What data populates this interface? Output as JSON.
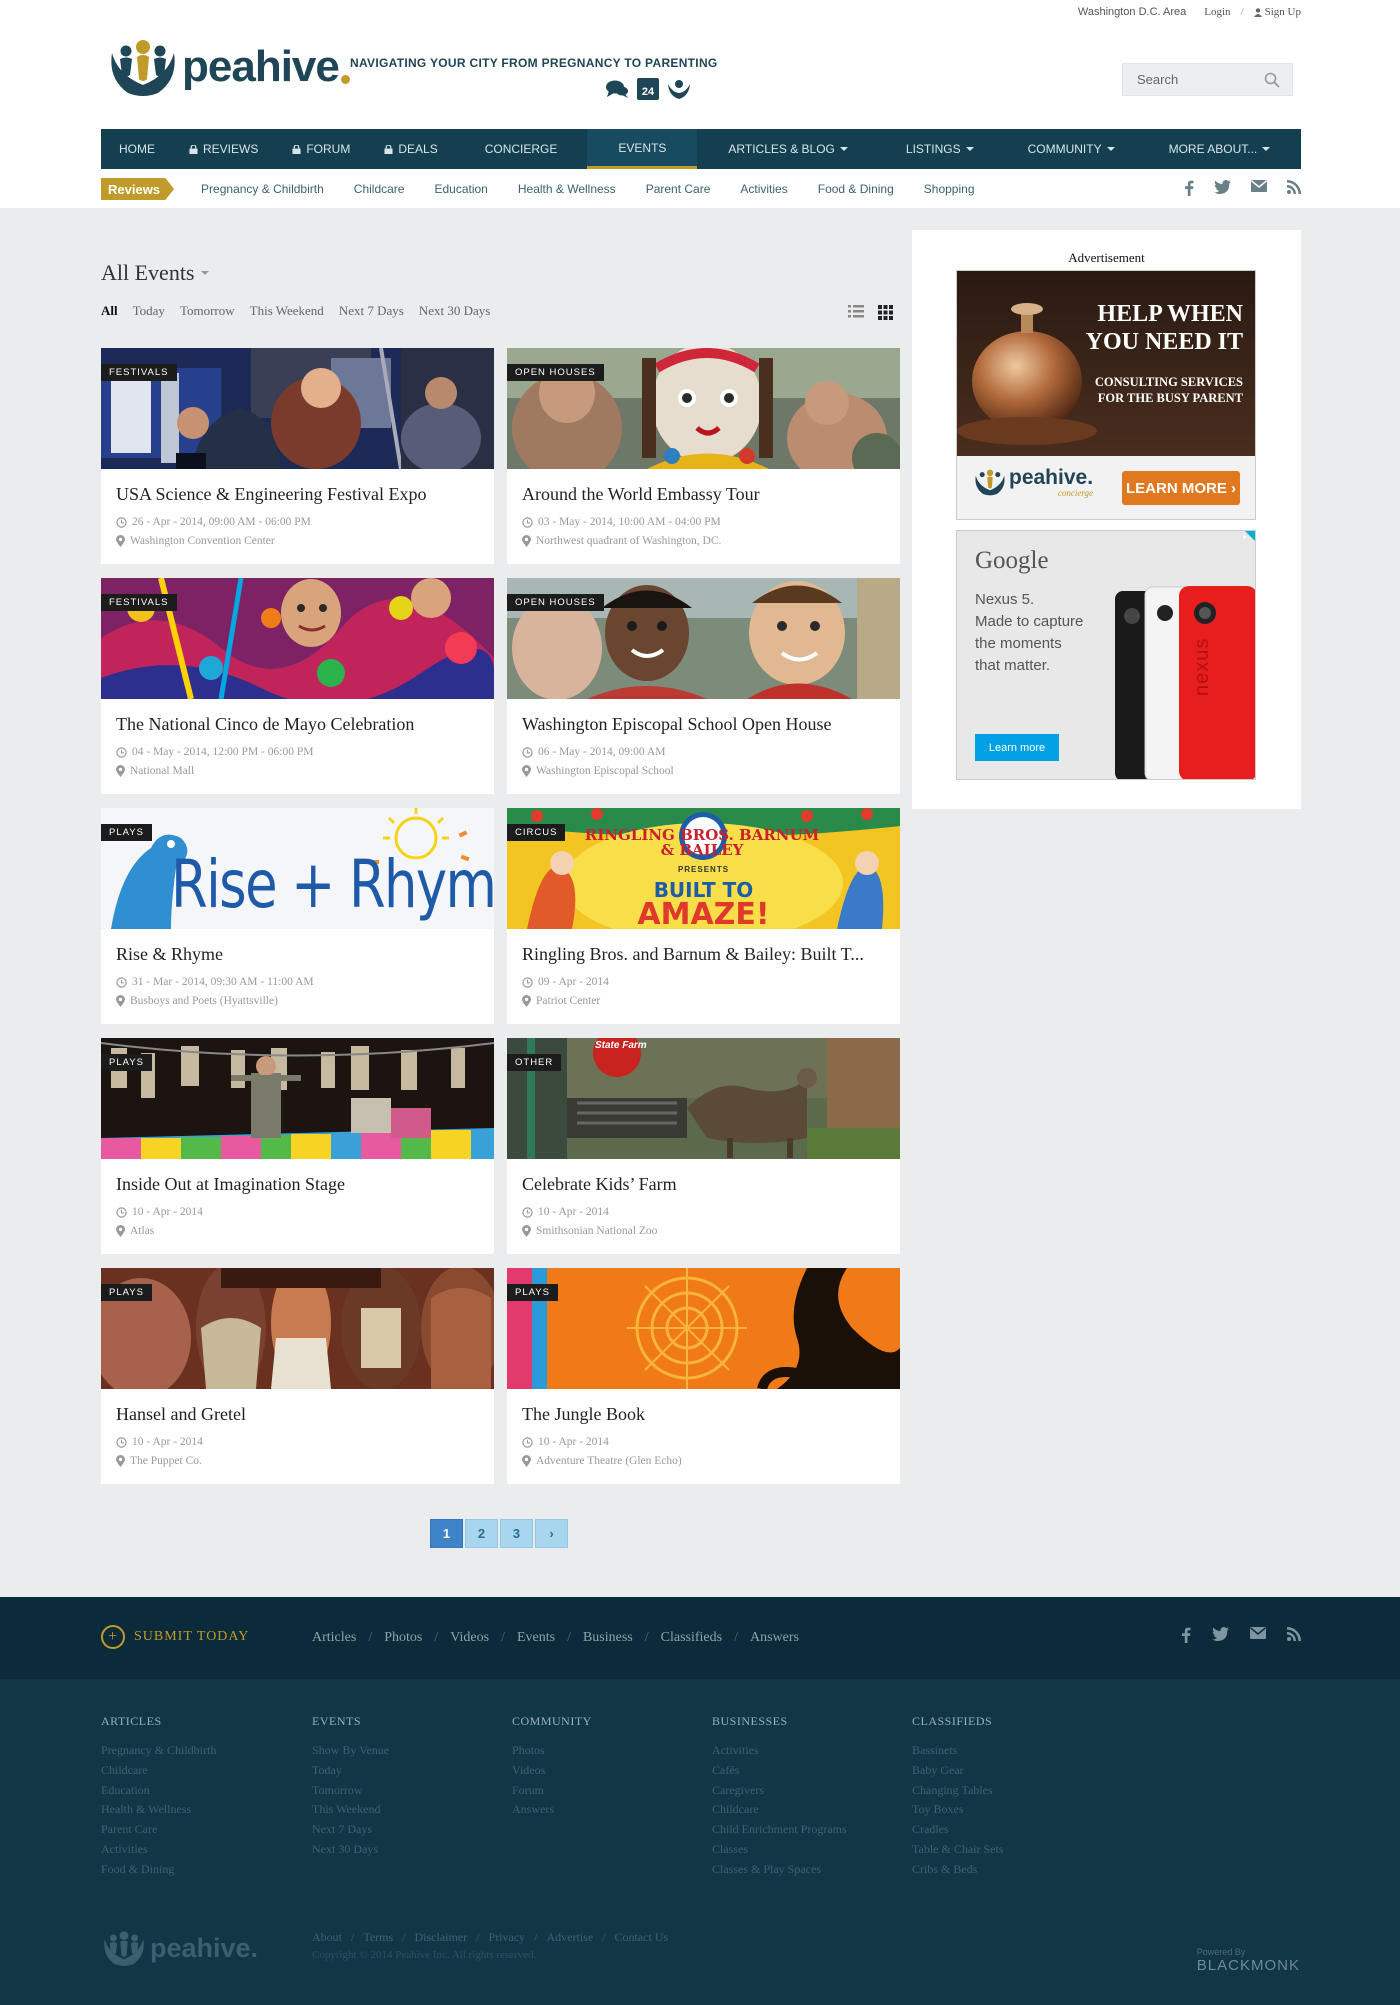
{
  "header": {
    "region": "Washington D.C. Area",
    "login": "Login",
    "signup": "Sign Up",
    "slash": "/",
    "brand": "peahive",
    "tagline": "NAVIGATING YOUR CITY FROM PREGNANCY TO PARENTING",
    "calendar_day": "24",
    "search_placeholder": "Search"
  },
  "main_nav": [
    {
      "label": "HOME"
    },
    {
      "label": "REVIEWS",
      "locked": true
    },
    {
      "label": "FORUM",
      "locked": true
    },
    {
      "label": "DEALS",
      "locked": true
    },
    {
      "label": "CONCIERGE"
    },
    {
      "label": "EVENTS",
      "active": true
    },
    {
      "label": "ARTICLES & BLOG",
      "dropdown": true
    },
    {
      "label": "LISTINGS",
      "dropdown": true
    },
    {
      "label": "COMMUNITY",
      "dropdown": true
    },
    {
      "label": "MORE ABOUT...",
      "dropdown": true
    }
  ],
  "sub_nav": {
    "badge": "Reviews",
    "items": [
      "Pregnancy & Childbirth",
      "Childcare",
      "Education",
      "Health & Wellness",
      "Parent Care",
      "Activities",
      "Food & Dining",
      "Shopping"
    ]
  },
  "events_page": {
    "heading": "All Events",
    "filters": [
      "All",
      "Today",
      "Tomorrow",
      "This Weekend",
      "Next 7 Days",
      "Next 30 Days"
    ],
    "active_filter": "All"
  },
  "events": [
    {
      "tag": "FESTIVALS",
      "title": "USA Science & Engineering Festival Expo",
      "date": "26 - Apr - 2014, 09:00 AM - 06:00 PM",
      "location": "Washington Convention Center"
    },
    {
      "tag": "OPEN HOUSES",
      "title": "Around the World Embassy Tour",
      "date": "03 - May - 2014, 10:00 AM - 04:00 PM",
      "location": "Northwest quadrant of Washington, DC."
    },
    {
      "tag": "FESTIVALS",
      "title": "The National Cinco de Mayo Celebration",
      "date": "04 - May - 2014, 12:00 PM - 06:00 PM",
      "location": "National Mall"
    },
    {
      "tag": "OPEN HOUSES",
      "title": "Washington Episcopal School Open House",
      "date": "06 - May - 2014, 09:00 AM",
      "location": "Washington Episcopal School"
    },
    {
      "tag": "PLAYS",
      "title": "Rise & Rhyme",
      "date": "31 - Mar - 2014, 09:30 AM - 11:00 AM",
      "location": "Busboys and Poets (Hyattsville)"
    },
    {
      "tag": "CIRCUS",
      "title": "Ringling Bros. and Barnum & Bailey: Built T...",
      "date": "09 - Apr - 2014",
      "location": "Patriot Center"
    },
    {
      "tag": "PLAYS",
      "title": "Inside Out at Imagination Stage",
      "date": "10 - Apr - 2014",
      "location": "Atlas"
    },
    {
      "tag": "OTHER",
      "title": "Celebrate Kids’ Farm",
      "date": "10 - Apr - 2014",
      "location": "Smithsonian National Zoo"
    },
    {
      "tag": "PLAYS",
      "title": "Hansel and Gretel",
      "date": "10 - Apr - 2014",
      "location": "The Puppet Co."
    },
    {
      "tag": "PLAYS",
      "title": "The Jungle Book",
      "date": "10 - Apr - 2014",
      "location": "Adventure Theatre (Glen Echo)"
    }
  ],
  "image_text": {
    "rise_rhyme": "Rise + Rhyme",
    "ringling_top": "RINGLING BROS. BARNUM & BAILEY",
    "ringling_presents": "PRESENTS",
    "ringling_built": "BUILT TO",
    "ringling_amaze": "AMAZE!",
    "statefarm": "State Farm"
  },
  "pagination": {
    "pages": [
      "1",
      "2",
      "3"
    ],
    "active": "1",
    "next": "›"
  },
  "sidebar": {
    "ad_label": "Advertisement",
    "ad1": {
      "line1": "HELP WHEN",
      "line2": "YOU NEED IT",
      "sub1": "CONSULTING SERVICES",
      "sub2": "FOR THE BUSY PARENT",
      "brand": "peahive.",
      "brand_sub": "concierge",
      "cta": "LEARN MORE ›"
    },
    "ad2": {
      "brand": "Google",
      "line1": "Nexus 5.",
      "line2": "Made to capture",
      "line3": "the moments",
      "line4": "that matter.",
      "cta": "Learn more",
      "phone_text": "nexus"
    }
  },
  "footer": {
    "submit": "SUBMIT TODAY",
    "links": [
      "Articles",
      "Photos",
      "Videos",
      "Events",
      "Business",
      "Classifieds",
      "Answers"
    ],
    "columns": [
      {
        "heading": "ARTICLES",
        "links": [
          "Pregnancy & Childbirth",
          "Childcare",
          "Education",
          "Health & Wellness",
          "Parent Care",
          "Activities",
          "Food & Dining"
        ]
      },
      {
        "heading": "EVENTS",
        "links": [
          "Show By Venue",
          "Today",
          "Tomorrow",
          "This Weekend",
          "Next 7 Days",
          "Next 30 Days"
        ]
      },
      {
        "heading": "COMMUNITY",
        "links": [
          "Photos",
          "Videos",
          "Forum",
          "Answers"
        ]
      },
      {
        "heading": "BUSINESSES",
        "links": [
          "Activities",
          "Cafés",
          "Caregivers",
          "Childcare",
          "Child Enrichment Programs",
          "Classes",
          "Classes & Play Spaces"
        ]
      },
      {
        "heading": "CLASSIFIEDS",
        "links": [
          "Bassinets",
          "Baby Gear",
          "Changing Tables",
          "Toy Boxes",
          "Cradles",
          "Table & Chair Sets",
          "Cribs & Beds"
        ]
      }
    ],
    "brand": "peahive.",
    "bottom_links": [
      "About",
      "Terms",
      "Disclaimer",
      "Privacy",
      "Advertise",
      "Contact Us"
    ],
    "copyright": "Copyright © 2014 Peahive Inc. All rights reserved.",
    "powered_by": "Powered By",
    "powered_brand": "BLACKMONK"
  },
  "colors": {
    "navy": "#133f50",
    "gold": "#c19b2a",
    "footer_dark": "#0c2b3a",
    "footer": "#113646",
    "page_active": "#3f84c8"
  }
}
